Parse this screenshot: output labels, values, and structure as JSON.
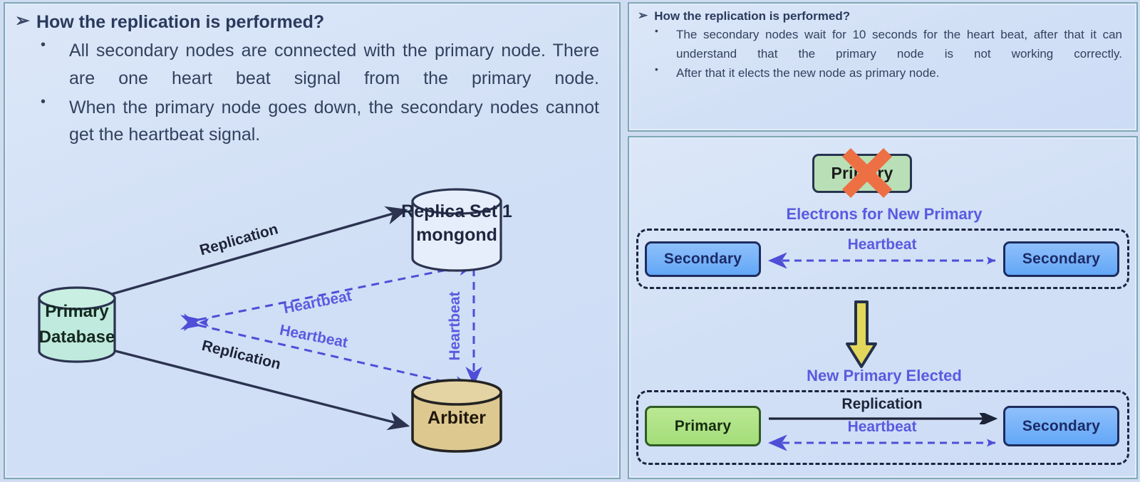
{
  "slide_left": {
    "heading": {
      "arrow_glyph": "➢",
      "text": "How the replication is performed?"
    },
    "bullets": [
      "All secondary nodes are connected with the primary node. There are one heart beat signal from the primary node.",
      "When the primary node goes down, the secondary nodes cannot get the heartbeat signal."
    ],
    "bullet_glyph": "•",
    "diagram": {
      "nodes": {
        "primary_database": "Primary\nDatabase",
        "primary_database_line1": "Primary",
        "primary_database_line2": "Database",
        "replica_set_line1": "Replica Set 1",
        "replica_set_line2": "mongond",
        "arbiter": "Arbiter"
      },
      "edges": {
        "replication_top": "Replication",
        "replication_bottom": "Replication",
        "heartbeat_top": "Heartbeat",
        "heartbeat_bottom": "Heartbeat",
        "heartbeat_vertical": "Heartbeat"
      },
      "colors": {
        "primary_database_fill": "#bfeadd",
        "replica_set_fill": "#e6eefb",
        "arbiter_fill": "#ddc890",
        "solid_edge": "#2b3350",
        "dashed_edge": "#4e4ed8"
      }
    }
  },
  "slide_right_top": {
    "heading": {
      "arrow_glyph": "➢",
      "text": "How the replication is performed?"
    },
    "bullets": [
      "The secondary nodes wait for 10 seconds for the heart beat, after that it can understand that the primary node is not working correctly.",
      "After that it elects the new node as primary node."
    ],
    "bullet_glyph": "•"
  },
  "slide_right_bottom": {
    "failed_primary": {
      "label": "Primary",
      "status": "failed",
      "cross_icon": "x-cross-icon",
      "cross_color": "#ec7044",
      "fill": "#b9dfb7"
    },
    "election_caption": "Electrons for New Primary",
    "election_group": {
      "left_node": "Secondary",
      "right_node": "Secondary",
      "link_label": "Heartbeat"
    },
    "transition_arrow": {
      "icon": "down-arrow-icon",
      "fill": "#e3d75b",
      "stroke": "#243049"
    },
    "elected_caption": "New Primary Elected",
    "elected_group": {
      "left_node": "Primary",
      "right_node": "Secondary",
      "top_link_label": "Replication",
      "bottom_link_label": "Heartbeat"
    },
    "colors": {
      "secondary_fill": "#6aaaf8",
      "primary_fill": "#a8df80",
      "caption_color": "#5a5ae0",
      "dashed_group_border": "#1b2440"
    }
  }
}
